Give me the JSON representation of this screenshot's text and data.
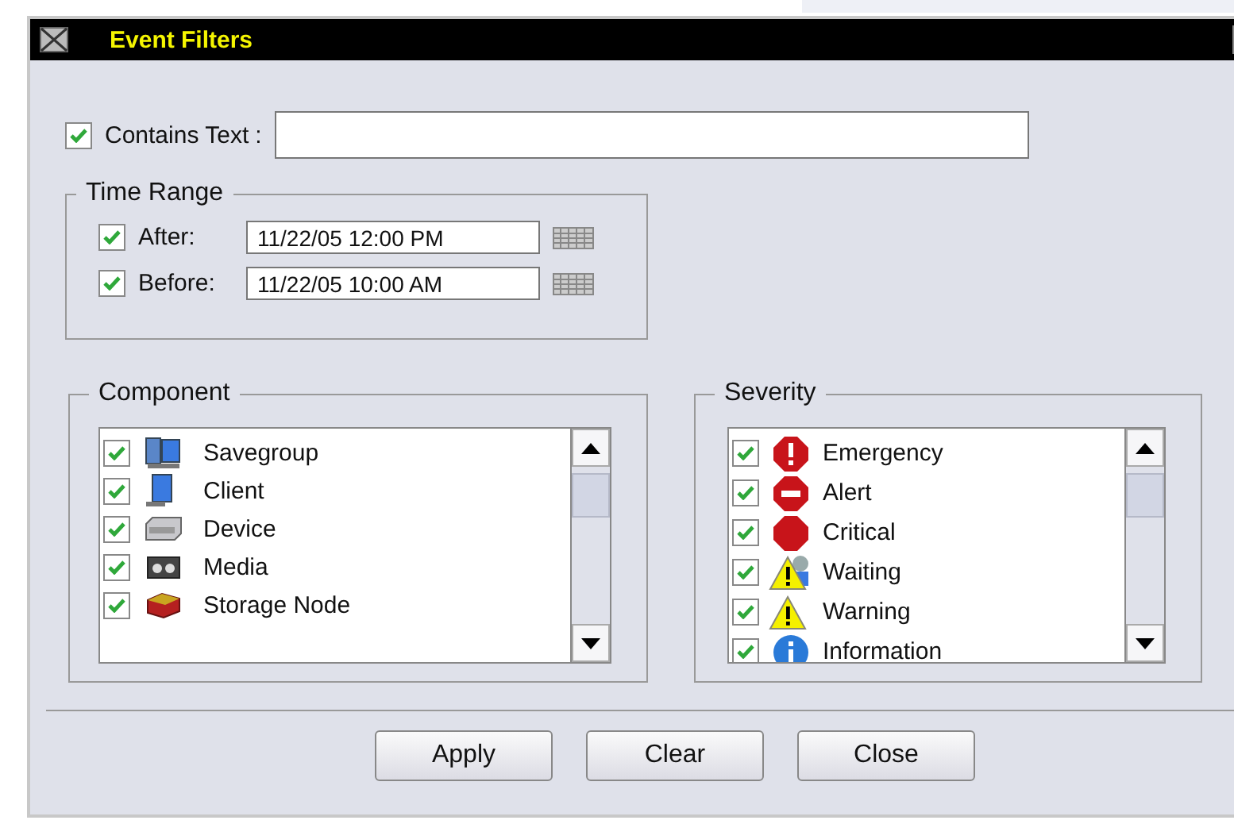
{
  "window": {
    "title": "Event Filters"
  },
  "contains_text": {
    "label": "Contains Text",
    "colon": ":",
    "checked": true
  },
  "time_range": {
    "title": "Time Range",
    "rows": [
      {
        "label": "After:",
        "checked": true,
        "value": "11/22/05 12:00 PM"
      },
      {
        "label": "Before:",
        "checked": true,
        "value": "11/22/05 10:00 AM"
      }
    ]
  },
  "component": {
    "title": "Component",
    "items": [
      {
        "label": "Savegroup",
        "checked": true,
        "kind": "savegroup"
      },
      {
        "label": "Client",
        "checked": true,
        "kind": "client"
      },
      {
        "label": "Device",
        "checked": true,
        "kind": "device"
      },
      {
        "label": "Media",
        "checked": true,
        "kind": "media"
      },
      {
        "label": "Storage Node",
        "checked": true,
        "kind": "storage"
      }
    ]
  },
  "severity": {
    "title": "Severity",
    "items": [
      {
        "label": "Emergency",
        "checked": true,
        "kind": "emergency"
      },
      {
        "label": "Alert",
        "checked": true,
        "kind": "alert"
      },
      {
        "label": "Critical",
        "checked": true,
        "kind": "critical"
      },
      {
        "label": "Waiting",
        "checked": true,
        "kind": "waiting"
      },
      {
        "label": "Warning",
        "checked": true,
        "kind": "warning"
      },
      {
        "label": "Information",
        "checked": true,
        "kind": "information"
      }
    ]
  },
  "buttons": [
    "Apply",
    "Clear",
    "Close"
  ]
}
